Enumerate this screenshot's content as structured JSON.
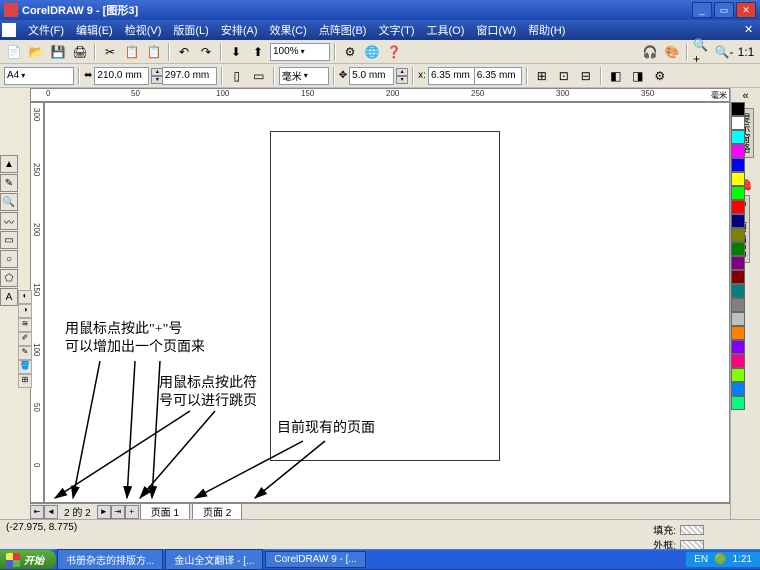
{
  "titlebar": {
    "title": "CorelDRAW 9 - [图形3]"
  },
  "menu": {
    "file": "文件(F)",
    "edit": "编辑(E)",
    "view": "检视(V)",
    "layout": "版面(L)",
    "arrange": "安排(A)",
    "effects": "效果(C)",
    "bitmap": "点阵图(B)",
    "text": "文字(T)",
    "tools": "工具(O)",
    "window": "窗口(W)",
    "help": "帮助(H)"
  },
  "toolbar": {
    "zoom": "100%"
  },
  "propbar": {
    "paper": "A4",
    "width": "210.0 mm",
    "height": "297.0 mm",
    "unit": "毫米",
    "nudge": "5.0 mm",
    "dup_x": "6.35 mm",
    "dup_y": "6.35 mm"
  },
  "ruler": {
    "unit": "毫米",
    "h_ticks": [
      "0",
      "50",
      "100",
      "150",
      "200",
      "250",
      "300",
      "350"
    ],
    "v_ticks": [
      "300",
      "250",
      "200",
      "150",
      "100",
      "50",
      "0"
    ]
  },
  "dock": {
    "hints": "提示窗格",
    "tutor": "CorelTUTOR"
  },
  "annotations": {
    "a1": "用鼠标点按此\"+\"号\n可以增加出一个页面来",
    "a2": "用鼠标点按此符\n号可以进行跳页",
    "a3": "目前现有的页面"
  },
  "pagebar": {
    "info": "2 的 2",
    "page1": "页面  1",
    "page2": "页面  2"
  },
  "status": {
    "coords": "(-27.975, 8.775)",
    "fill": "填充:",
    "outline": "外框:"
  },
  "taskbar": {
    "start": "开始",
    "task1": "书册杂志的排版方...",
    "task2": "金山全文翻译 - [...",
    "task3": "CorelDRAW 9 - [...",
    "time": "1:21",
    "lang": "EN"
  },
  "palette": [
    "#000",
    "#fff",
    "#00ffff",
    "#ff00ff",
    "#0000ff",
    "#ffff00",
    "#00ff00",
    "#ff0000",
    "#000080",
    "#808000",
    "#008000",
    "#800080",
    "#800000",
    "#008080",
    "#808080",
    "#c0c0c0",
    "#ff8000",
    "#8000ff",
    "#ff0080",
    "#80ff00",
    "#0080ff",
    "#00ff80"
  ]
}
